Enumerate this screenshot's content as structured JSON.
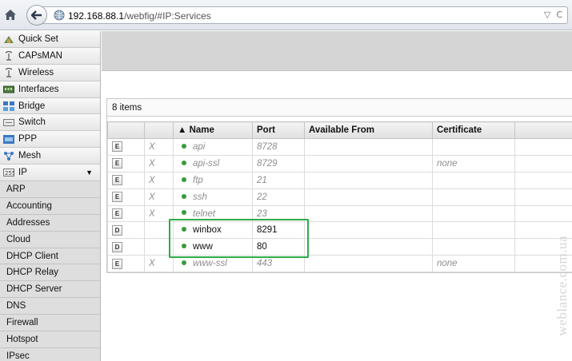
{
  "browser": {
    "url_host": "192.168.88.1",
    "url_path": "/webfig/#IP:Services"
  },
  "sidebar": {
    "items": [
      {
        "label": "Quick Set",
        "icon": "quick-set-icon"
      },
      {
        "label": "CAPsMAN",
        "icon": "antenna-icon"
      },
      {
        "label": "Wireless",
        "icon": "antenna-icon"
      },
      {
        "label": "Interfaces",
        "icon": "interfaces-icon"
      },
      {
        "label": "Bridge",
        "icon": "bridge-icon"
      },
      {
        "label": "Switch",
        "icon": "switch-icon"
      },
      {
        "label": "PPP",
        "icon": "ppp-icon"
      },
      {
        "label": "Mesh",
        "icon": "mesh-icon"
      },
      {
        "label": "IP",
        "icon": "ip-icon"
      }
    ],
    "ip_submenu": [
      "ARP",
      "Accounting",
      "Addresses",
      "Cloud",
      "DHCP Client",
      "DHCP Relay",
      "DHCP Server",
      "DNS",
      "Firewall",
      "Hotspot",
      "IPsec"
    ]
  },
  "services": {
    "count_label": "8 items",
    "columns": {
      "name": "▲ Name",
      "port": "Port",
      "available_from": "Available From",
      "certificate": "Certificate"
    },
    "rows": [
      {
        "flag": "E",
        "x": "X",
        "name": "api",
        "port": "8728",
        "available_from": "",
        "certificate": ""
      },
      {
        "flag": "E",
        "x": "X",
        "name": "api-ssl",
        "port": "8729",
        "available_from": "",
        "certificate": "none"
      },
      {
        "flag": "E",
        "x": "X",
        "name": "ftp",
        "port": "21",
        "available_from": "",
        "certificate": ""
      },
      {
        "flag": "E",
        "x": "X",
        "name": "ssh",
        "port": "22",
        "available_from": "",
        "certificate": ""
      },
      {
        "flag": "E",
        "x": "X",
        "name": "telnet",
        "port": "23",
        "available_from": "",
        "certificate": ""
      },
      {
        "flag": "D",
        "x": "",
        "name": "winbox",
        "port": "8291",
        "available_from": "",
        "certificate": ""
      },
      {
        "flag": "D",
        "x": "",
        "name": "www",
        "port": "80",
        "available_from": "",
        "certificate": ""
      },
      {
        "flag": "E",
        "x": "X",
        "name": "www-ssl",
        "port": "443",
        "available_from": "",
        "certificate": "none"
      }
    ]
  },
  "watermark": "weblance.com.ua",
  "colors": {
    "highlight": "#2eac49",
    "status_dot": "#3b9a3b"
  }
}
